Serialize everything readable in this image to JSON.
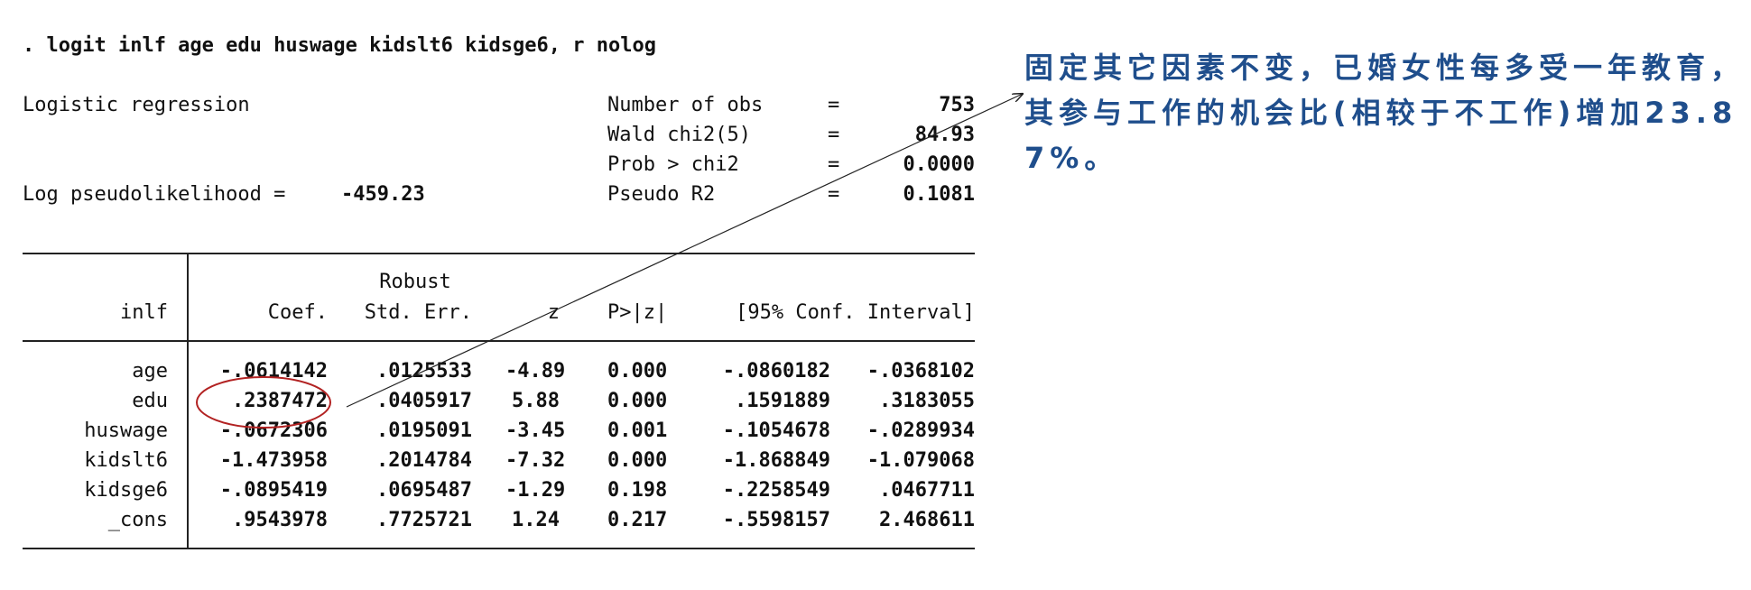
{
  "command": ". logit inlf age edu huswage kidslt6 kidsge6, r nolog",
  "model_title": "Logistic regression",
  "stats": [
    {
      "label": "Number of obs",
      "eq": "=",
      "value": "753"
    },
    {
      "label": "Wald chi2(5)",
      "eq": "=",
      "value": "84.93"
    },
    {
      "label": "Prob > chi2",
      "eq": "=",
      "value": "0.0000"
    },
    {
      "label": "Pseudo R2",
      "eq": "=",
      "value": "0.1081"
    }
  ],
  "loglik": {
    "label": "Log pseudolikelihood =",
    "value": "-459.23"
  },
  "table": {
    "header_top": "Robust",
    "columns": [
      "inlf",
      "Coef.",
      "Std. Err.",
      "z",
      "P>|z|",
      "[95% Conf. Interval]"
    ],
    "rows": [
      {
        "var": "age",
        "coef": "-.0614142",
        "se": ".0125533",
        "z": "-4.89",
        "p": "0.000",
        "lo": "-.0860182",
        "hi": "-.0368102"
      },
      {
        "var": "edu",
        "coef": ".2387472",
        "se": ".0405917",
        "z": "5.88",
        "p": "0.000",
        "lo": ".1591889",
        "hi": ".3183055"
      },
      {
        "var": "huswage",
        "coef": "-.0672306",
        "se": ".0195091",
        "z": "-3.45",
        "p": "0.001",
        "lo": "-.1054678",
        "hi": "-.0289934"
      },
      {
        "var": "kidslt6",
        "coef": "-1.473958",
        "se": ".2014784",
        "z": "-7.32",
        "p": "0.000",
        "lo": "-1.868849",
        "hi": "-1.079068"
      },
      {
        "var": "kidsge6",
        "coef": "-.0895419",
        "se": ".0695487",
        "z": "-1.29",
        "p": "0.198",
        "lo": "-.2258549",
        "hi": ".0467711"
      },
      {
        "var": "_cons",
        "coef": ".9543978",
        "se": ".7725721",
        "z": "1.24",
        "p": "0.217",
        "lo": "-.5598157",
        "hi": "2.468611"
      }
    ]
  },
  "annotation": {
    "text": "固定其它因素不变，已婚女性每多受一年教育，其参与工作的机会比(相较于不工作)增加23.87%。",
    "color": "#1f4e8c",
    "highlight_color": "#b22222"
  }
}
